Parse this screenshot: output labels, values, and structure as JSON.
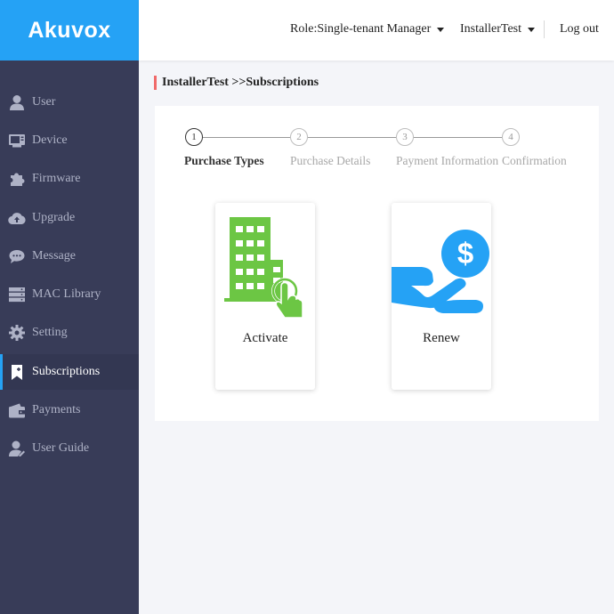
{
  "logo": {
    "text": "Akuvox"
  },
  "header": {
    "role": "Role:Single-tenant Manager",
    "user": "InstallerTest",
    "logout": "Log out"
  },
  "sidebar": {
    "items": [
      {
        "label": "User",
        "icon": "user-icon"
      },
      {
        "label": "Device",
        "icon": "device-icon"
      },
      {
        "label": "Firmware",
        "icon": "puzzle-icon"
      },
      {
        "label": "Upgrade",
        "icon": "cloud-upload-icon"
      },
      {
        "label": "Message",
        "icon": "message-icon"
      },
      {
        "label": "MAC Library",
        "icon": "server-icon"
      },
      {
        "label": "Setting",
        "icon": "gear-icon"
      },
      {
        "label": "Subscriptions",
        "icon": "bookmark-icon",
        "active": true
      },
      {
        "label": "Payments",
        "icon": "wallet-icon"
      },
      {
        "label": "User Guide",
        "icon": "user-guide-icon"
      }
    ]
  },
  "breadcrumb": {
    "text": "InstallerTest >>Subscriptions"
  },
  "steps": [
    {
      "number": "1",
      "label": "Purchase Types",
      "active": true
    },
    {
      "number": "2",
      "label": "Purchase Details"
    },
    {
      "number": "3",
      "label": "Payment Information"
    },
    {
      "number": "4",
      "label": "Confirmation"
    }
  ],
  "cards": [
    {
      "label": "Activate",
      "icon": "building-tap-icon"
    },
    {
      "label": "Renew",
      "icon": "hand-dollar-icon"
    }
  ],
  "colors": {
    "brand": "#25a2f5",
    "sidebar": "#383c58",
    "breadcrumb_accent": "#f06a6a",
    "activate_icon": "#6cc644",
    "renew_icon": "#25a2f5"
  }
}
